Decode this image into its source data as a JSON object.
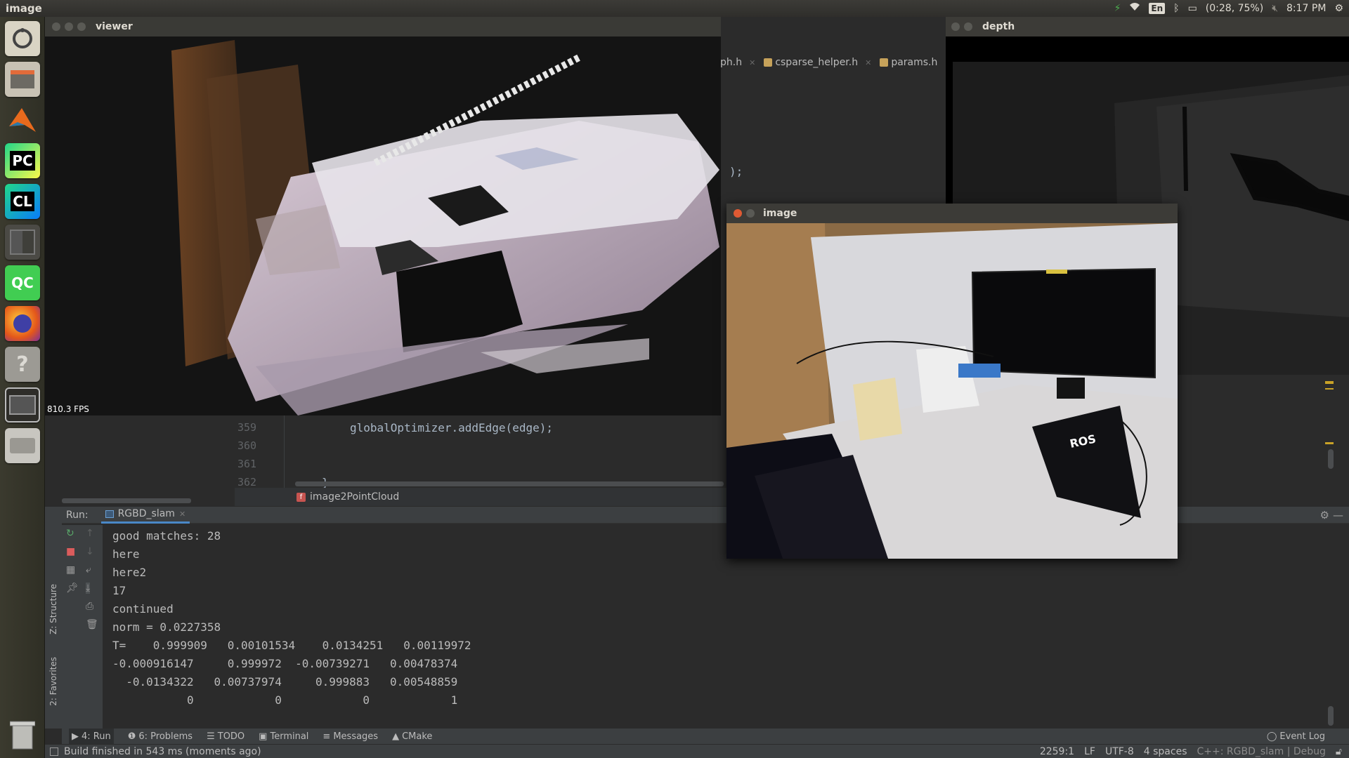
{
  "top_panel": {
    "title": "image",
    "keyboard": "En",
    "battery": "(0:28, 75%)",
    "time": "8:17 PM"
  },
  "launcher": {
    "items": [
      {
        "name": "dash",
        "label": ""
      },
      {
        "name": "files",
        "label": ""
      },
      {
        "name": "matlab",
        "label": ""
      },
      {
        "name": "pycharm",
        "label": "PC"
      },
      {
        "name": "clion",
        "label": "CL"
      },
      {
        "name": "workspaces",
        "label": ""
      },
      {
        "name": "qtcreator",
        "label": "QC"
      },
      {
        "name": "firefox",
        "label": ""
      },
      {
        "name": "help",
        "label": "?"
      },
      {
        "name": "window",
        "label": ""
      },
      {
        "name": "drive",
        "label": ""
      },
      {
        "name": "trash",
        "label": ""
      }
    ]
  },
  "windows": {
    "viewer": {
      "title": "viewer",
      "fps": "810.3 FPS"
    },
    "depth": {
      "title": "depth"
    },
    "image": {
      "title": "image"
    }
  },
  "editor": {
    "tabs": [
      {
        "label": "ph.h"
      },
      {
        "label": "csparse_helper.h"
      },
      {
        "label": "params.h"
      }
    ],
    "code_fragment": ");",
    "lines": [
      {
        "num": "359",
        "text": "globalOptimizer.addEdge(edge);"
      },
      {
        "num": "360",
        "text": ""
      },
      {
        "num": "361",
        "text": ""
      },
      {
        "num": "362",
        "text": "}"
      }
    ],
    "breadcrumb": "image2PointCloud"
  },
  "run_panel": {
    "label": "Run:",
    "config": "RGBD_slam",
    "output": [
      "good matches: 28",
      "here",
      "here2",
      "17",
      "continued",
      "norm = 0.0227358",
      "T=    0.999909   0.00101534    0.0134251   0.00119972",
      "-0.000916147     0.999972  -0.00739271   0.00478374",
      "  -0.0134322   0.00737974     0.999883   0.00548859",
      "           0            0            0            1"
    ]
  },
  "side_strip": {
    "structure": "Z: Structure",
    "favorites": "2: Favorites"
  },
  "tool_strip": {
    "items": [
      {
        "label": "4: Run"
      },
      {
        "label": "6: Problems"
      },
      {
        "label": "TODO"
      },
      {
        "label": "Terminal"
      },
      {
        "label": "Messages"
      },
      {
        "label": "CMake"
      }
    ],
    "event_log": "Event Log"
  },
  "status_bar": {
    "message": "Build finished in 543 ms (moments ago)",
    "position": "2259:1",
    "line_sep": "LF",
    "encoding": "UTF-8",
    "indent": "4 spaces",
    "context": "C++: RGBD_slam | Debug"
  },
  "colors": {
    "ide_bg": "#2b2b2b",
    "panel": "#3c3f41",
    "ubuntu_panel": "#3c3b37",
    "close_red": "#e05a33"
  }
}
